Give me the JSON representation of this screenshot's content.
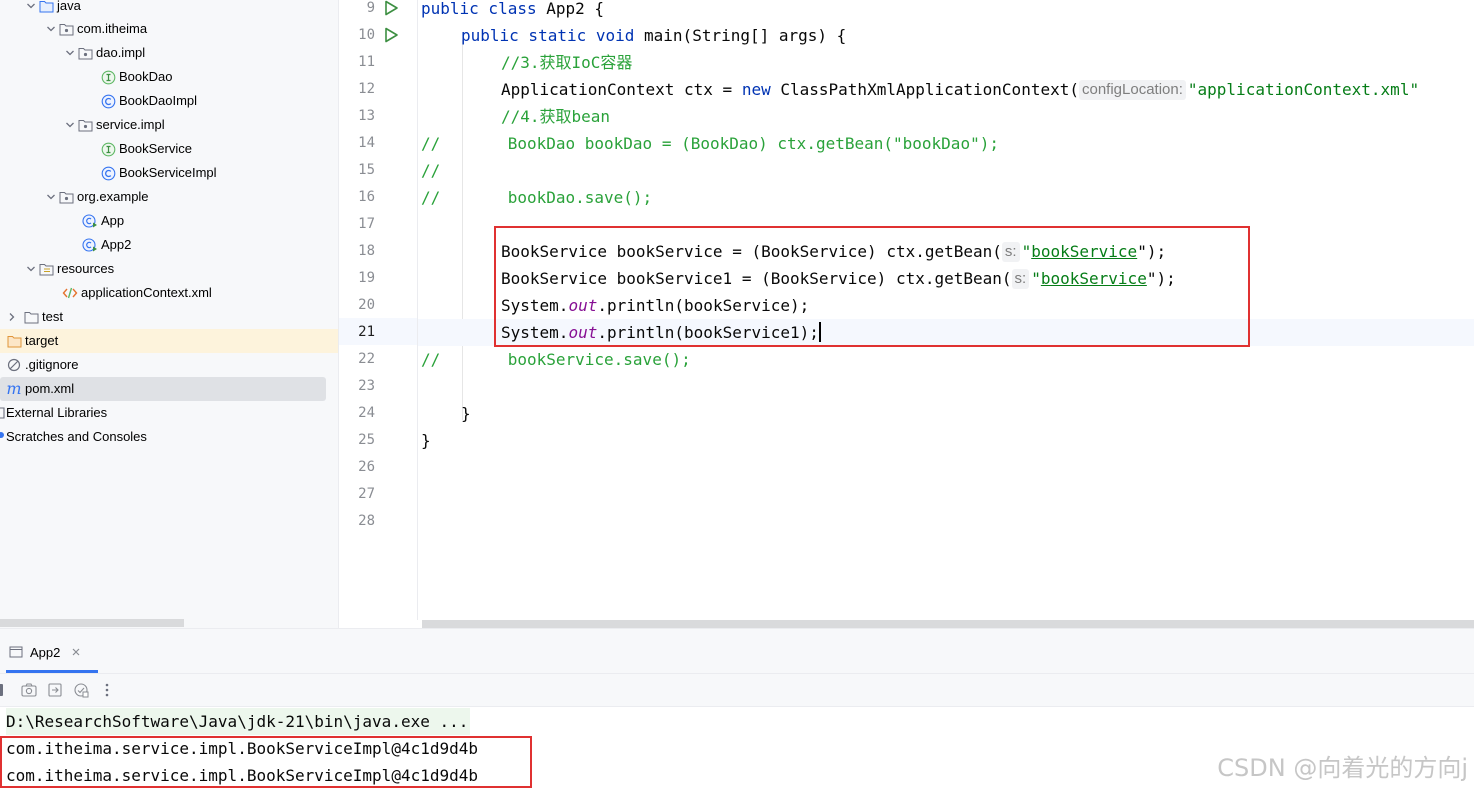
{
  "tree": {
    "items": [
      {
        "label": "java",
        "kind": "folder-blue"
      },
      {
        "label": "com.itheima",
        "kind": "package"
      },
      {
        "label": "dao.impl",
        "kind": "package"
      },
      {
        "label": "BookDao",
        "kind": "interface"
      },
      {
        "label": "BookDaoImpl",
        "kind": "class"
      },
      {
        "label": "service.impl",
        "kind": "package"
      },
      {
        "label": "BookService",
        "kind": "interface"
      },
      {
        "label": "BookServiceImpl",
        "kind": "class"
      },
      {
        "label": "org.example",
        "kind": "package"
      },
      {
        "label": "App",
        "kind": "runnable-class"
      },
      {
        "label": "App2",
        "kind": "runnable-class"
      },
      {
        "label": "resources",
        "kind": "resources-folder"
      },
      {
        "label": "applicationContext.xml",
        "kind": "xml-file"
      },
      {
        "label": "test",
        "kind": "folder"
      },
      {
        "label": "target",
        "kind": "folder-orange"
      },
      {
        "label": ".gitignore",
        "kind": "ignore-file"
      },
      {
        "label": "pom.xml",
        "kind": "maven-file"
      },
      {
        "label": "External Libraries",
        "kind": "libraries"
      },
      {
        "label": "Scratches and Consoles",
        "kind": "scratches"
      }
    ]
  },
  "editor": {
    "line_numbers": [
      "9",
      "10",
      "11",
      "12",
      "13",
      "14",
      "15",
      "16",
      "17",
      "18",
      "19",
      "20",
      "21",
      "22",
      "23",
      "24",
      "25",
      "26",
      "27",
      "28"
    ],
    "code": {
      "l9_kw": "public class",
      "l9_rest": " App2 {",
      "l10_kw1": "public static void",
      "l10_rest": " main(String[] args) {",
      "l11_comment": "//3.获取IoC容器",
      "l12_a": "ApplicationContext ctx = ",
      "l12_kw": "new",
      "l12_b": " ClassPathXmlApplicationContext(",
      "l12_hint": "configLocation:",
      "l12_str": "\"applicationContext.xml\"",
      "l13_comment": "//4.获取bean",
      "l14_comment": "//       BookDao bookDao = (BookDao) ctx.getBean(\"bookDao\");",
      "l15_comment": "//",
      "l16_comment": "//       bookDao.save();",
      "l18_a": "BookService bookService = (BookService) ctx.getBean(",
      "l18_hint": "s:",
      "l18_q1": "\"",
      "l18_str": "bookService",
      "l18_end": "\");",
      "l19_a": "BookService bookService1 = (BookService) ctx.getBean(",
      "l19_hint": "s:",
      "l19_q1": "\"",
      "l19_str": "bookService",
      "l19_end": "\");",
      "l20_a": "System.",
      "l20_it": "out",
      "l20_b": ".println(bookService);",
      "l21_a": "System.",
      "l21_it": "out",
      "l21_b": ".println(bookService1);",
      "l22_comment": "//       bookService.save();",
      "l24": "}",
      "l25": "}"
    }
  },
  "run_panel": {
    "tab_label": "App2",
    "console_lines": [
      "D:\\ResearchSoftware\\Java\\jdk-21\\bin\\java.exe ...",
      "com.itheima.service.impl.BookServiceImpl@4c1d9d4b",
      "com.itheima.service.impl.BookServiceImpl@4c1d9d4b"
    ]
  },
  "watermark": "CSDN @向着光的方向j",
  "colors": {
    "keyword": "#0033b3",
    "comment": "#2aa23a",
    "string": "#067d17",
    "static_field": "#871094",
    "highlight_box": "#e03131"
  }
}
